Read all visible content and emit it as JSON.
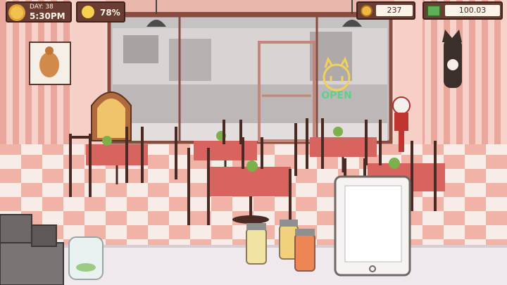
{
  "hud": {
    "day_label": "DAY: 38",
    "time": "5:30PM",
    "happiness": "78%",
    "coins": "237",
    "cash": "100.03"
  },
  "icons": {
    "sun": "sun-icon",
    "smiley": "smiley-icon",
    "coin": "coin-icon",
    "cash": "cash-icon"
  },
  "sign": {
    "open": "OPEN"
  },
  "colors": {
    "hud_brown": "#6b3d32",
    "table_red": "#d9645f",
    "floor_pink": "#f1b7a9",
    "open_sign": "#5fd08a",
    "cat_sign": "#f0d25a"
  }
}
